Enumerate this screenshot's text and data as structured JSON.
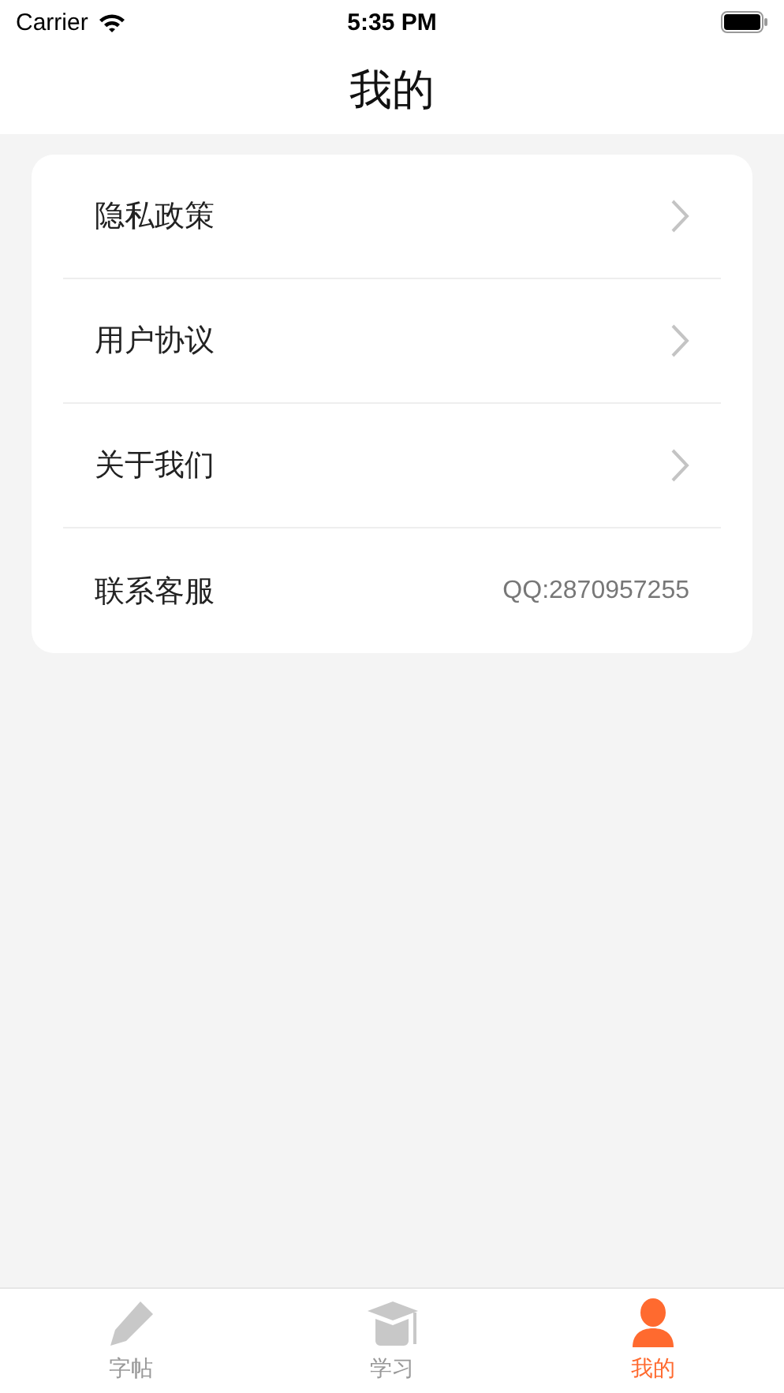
{
  "status_bar": {
    "carrier": "Carrier",
    "time": "5:35 PM"
  },
  "nav": {
    "title": "我的"
  },
  "menu": [
    {
      "kind": "link",
      "label": "隐私政策"
    },
    {
      "kind": "link",
      "label": "用户协议"
    },
    {
      "kind": "link",
      "label": "关于我们"
    },
    {
      "kind": "value",
      "label": "联系客服",
      "value": "QQ:2870957255"
    }
  ],
  "tabs": [
    {
      "kind": "pencil",
      "label": "字帖",
      "selected": false
    },
    {
      "kind": "cap",
      "label": "学习",
      "selected": false
    },
    {
      "kind": "person",
      "label": "我的",
      "selected": true
    }
  ]
}
